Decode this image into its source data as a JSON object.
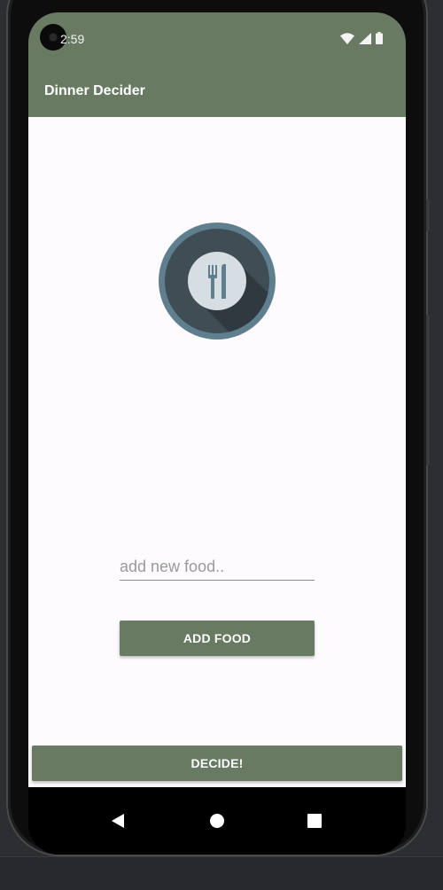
{
  "status_bar": {
    "time": "2:59",
    "icons": [
      "camera-icon",
      "wifi-icon",
      "cellular-signal-icon",
      "battery-icon"
    ]
  },
  "app_bar": {
    "title": "Dinner Decider"
  },
  "logo": {
    "icon": "fork-knife-icon"
  },
  "food_input": {
    "value": "",
    "placeholder": "add new food.."
  },
  "add_button": {
    "label": "ADD FOOD"
  },
  "decide_button": {
    "label": "DECIDE!"
  },
  "nav_bar": {
    "icons": [
      "back-icon",
      "home-icon",
      "recents-icon"
    ]
  },
  "colors": {
    "primary": "#687a62",
    "background": "#fdfbfd",
    "logo_ring": "#5f7f8e",
    "logo_inner": "#3f4d55",
    "plate": "#d6dde3"
  }
}
